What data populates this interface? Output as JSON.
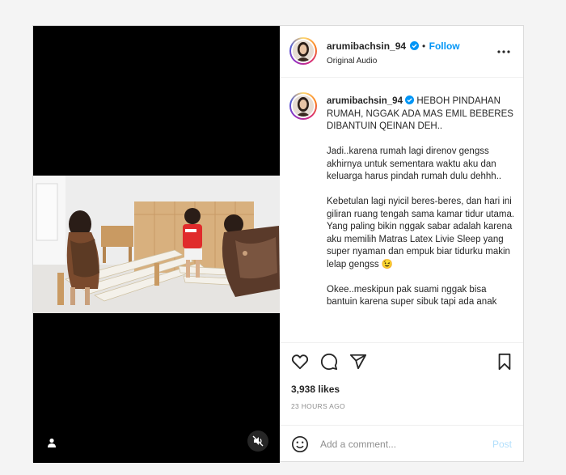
{
  "post": {
    "username": "arumibachsin_94",
    "separator": "•",
    "follow_label": "Follow",
    "audio_label": "Original Audio",
    "caption_title": "HEBOH PINDAHAN RUMAH, NGGAK ADA MAS EMIL BEBERES DIBANTUIN QEINAN DEH..",
    "caption_paragraphs": [
      "Jadi..karena rumah lagi direnov gengss akhirnya untuk sementara waktu aku dan keluarga harus pindah rumah dulu dehhh..",
      "Kebetulan lagi nyicil beres-beres, dan hari ini giliran ruang tengah sama kamar tidur utama. Yang paling bikin nggak sabar adalah karena aku memilih Matras Latex Livie Sleep yang super nyaman dan empuk biar tidurku makin lelap gengss 😉",
      "Okee..meskipun pak suami nggak bisa bantuin karena super sibuk tapi ada anak"
    ],
    "likes": "3,938 likes",
    "timestamp": "23 HOURS AGO",
    "comment_placeholder": "Add a comment...",
    "post_label": "Post"
  },
  "icons": {
    "verified": "verified-badge-icon",
    "more": "more-options-icon",
    "like": "heart-icon",
    "comment": "comment-icon",
    "share": "share-icon",
    "save": "bookmark-icon",
    "emoji": "emoji-icon",
    "mute": "mute-icon",
    "tag": "user-tag-icon"
  },
  "colors": {
    "accent": "#0095f6",
    "post_disabled": "#b2dffc",
    "muted_text": "#8e8e8e",
    "media_bg": "#000000"
  }
}
